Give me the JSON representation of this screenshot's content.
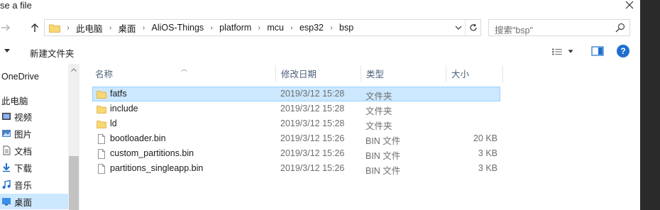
{
  "window": {
    "title": "se a file",
    "close_glyph": "✕"
  },
  "address": {
    "crumbs": [
      "此电脑",
      "桌面",
      "AliOS-Things",
      "platform",
      "mcu",
      "esp32",
      "bsp"
    ]
  },
  "search": {
    "placeholder": "搜索\"bsp\""
  },
  "toolbar": {
    "new_folder_label": "新建文件夹",
    "help_label": "?"
  },
  "nav": {
    "items": [
      {
        "label": "OneDrive",
        "icon": "onedrive-icon"
      },
      {
        "label": "此电脑",
        "icon": "this-pc-icon"
      },
      {
        "label": "视频",
        "icon": "videos-icon"
      },
      {
        "label": "图片",
        "icon": "pictures-icon"
      },
      {
        "label": "文档",
        "icon": "documents-icon"
      },
      {
        "label": "下载",
        "icon": "downloads-icon"
      },
      {
        "label": "音乐",
        "icon": "music-icon"
      },
      {
        "label": "桌面",
        "icon": "desktop-icon",
        "selected": true
      }
    ]
  },
  "columns": {
    "name": "名称",
    "date": "修改日期",
    "type": "类型",
    "size": "大小"
  },
  "files": [
    {
      "name": "fatfs",
      "date": "2019/3/12 15:28",
      "type": "文件夹",
      "size": "",
      "kind": "folder",
      "selected": true
    },
    {
      "name": "include",
      "date": "2019/3/12 15:28",
      "type": "文件夹",
      "size": "",
      "kind": "folder"
    },
    {
      "name": "ld",
      "date": "2019/3/12 15:28",
      "type": "文件夹",
      "size": "",
      "kind": "folder"
    },
    {
      "name": "bootloader.bin",
      "date": "2019/3/12 15:26",
      "type": "BIN 文件",
      "size": "20 KB",
      "kind": "file"
    },
    {
      "name": "custom_partitions.bin",
      "date": "2019/3/12 15:26",
      "type": "BIN 文件",
      "size": "3 KB",
      "kind": "file"
    },
    {
      "name": "partitions_singleapp.bin",
      "date": "2019/3/12 15:26",
      "type": "BIN 文件",
      "size": "3 KB",
      "kind": "file"
    }
  ],
  "colors": {
    "selection": "#cce8ff",
    "selection_border": "#99d1ff",
    "folder": "#f8d775",
    "accent": "#1f6fcf"
  }
}
